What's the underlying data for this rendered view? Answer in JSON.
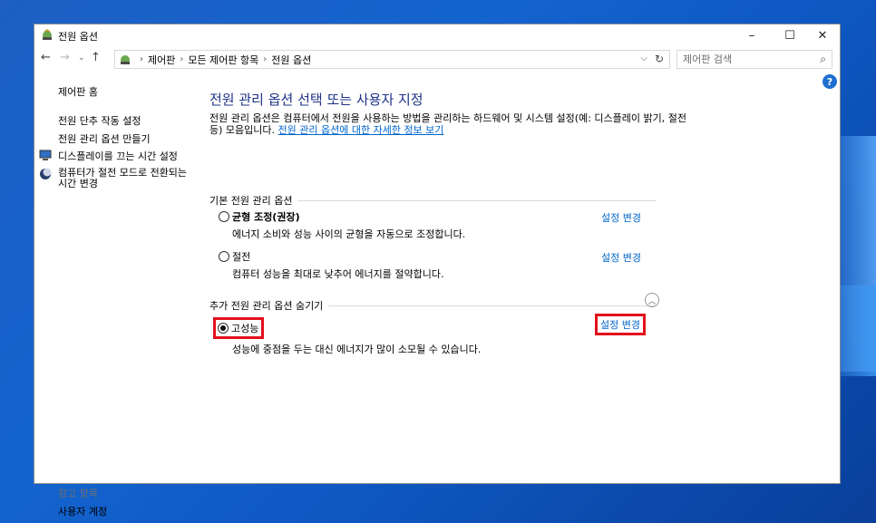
{
  "window": {
    "title": "전원 옵션",
    "minimize": "–",
    "maximize": "☐",
    "close": "✕"
  },
  "address": {
    "breadcrumbs": [
      "제어판",
      "모든 제어판 항목",
      "전원 옵션"
    ],
    "separator": "›",
    "search_placeholder": "제어판 검색"
  },
  "sidebar": {
    "home": "제어판 홈",
    "items": [
      "전원 단추 작동 설정",
      "전원 관리 옵션 만들기",
      "디스플레이를 끄는 시간 설정",
      "컴퓨터가 절전 모드로 전환되는 시간 변경"
    ],
    "see_also_title": "참고 항목",
    "see_also_link": "사용자 계정"
  },
  "main": {
    "title": "전원 관리 옵션 선택 또는 사용자 지정",
    "description": "전원 관리 옵션은 컴퓨터에서 전원을 사용하는 방법을 관리하는 하드웨어 및 시스템 설정(예: 디스플레이 밝기, 절전 등) 모음입니다.",
    "description_link": "전원 관리 옵션에 대한 자세한 정보 보기",
    "basic_section": "기본 전원 관리 옵션",
    "extra_section": "추가 전원 관리 옵션 숨기기",
    "plans": {
      "balanced": {
        "name": "균형 조정(권장)",
        "desc": "에너지 소비와 성능 사이의 균형을 자동으로 조정합니다.",
        "link": "설정 변경",
        "selected": false
      },
      "saver": {
        "name": "절전",
        "desc": "컴퓨터 성능을 최대로 낮추어 에너지를 절약합니다.",
        "link": "설정 변경",
        "selected": false
      },
      "high": {
        "name": "고성능",
        "desc": "성능에 중점을 두는 대신 에너지가 많이 소모될 수 있습니다.",
        "link": "설정 변경",
        "selected": true
      }
    }
  },
  "colors": {
    "title_blue": "#1e3287",
    "link_blue": "#0066cc",
    "highlight_red": "#e2101b"
  }
}
